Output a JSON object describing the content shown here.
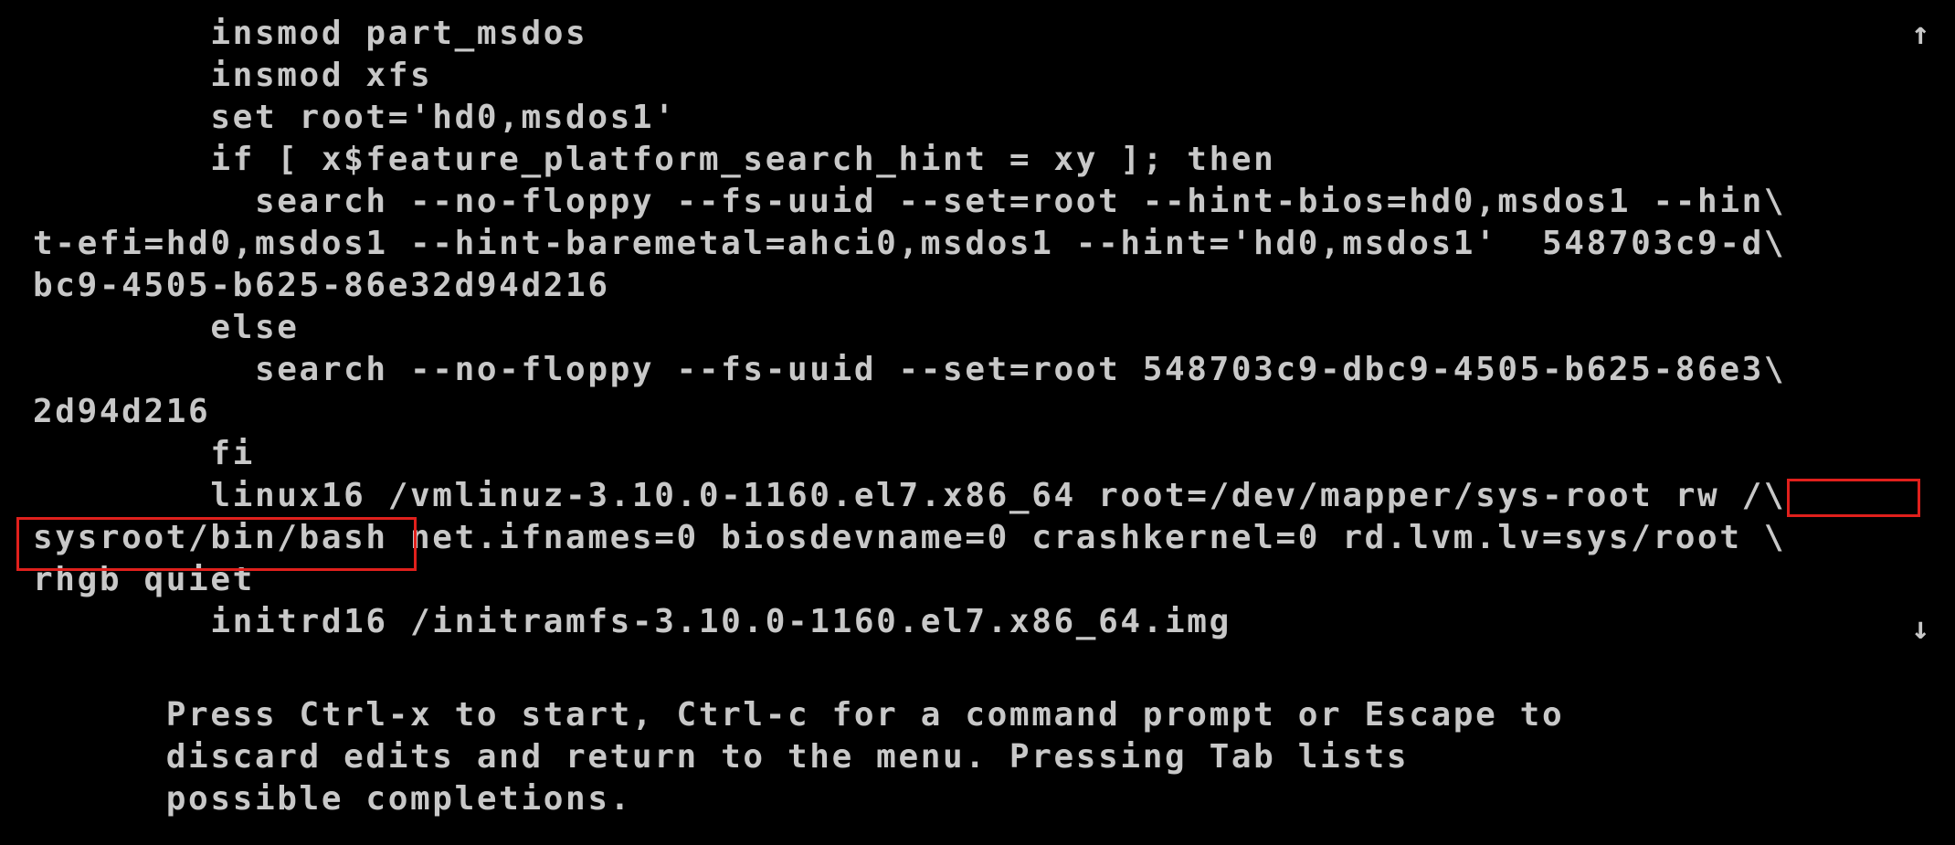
{
  "editor": {
    "scroll_up_icon": "↑",
    "scroll_down_icon": "↓",
    "lines": [
      "        insmod part_msdos",
      "        insmod xfs",
      "        set root='hd0,msdos1'",
      "        if [ x$feature_platform_search_hint = xy ]; then",
      "          search --no-floppy --fs-uuid --set=root --hint-bios=hd0,msdos1 --hin\\",
      "t-efi=hd0,msdos1 --hint-baremetal=ahci0,msdos1 --hint='hd0,msdos1'  548703c9-d\\",
      "bc9-4505-b625-86e32d94d216",
      "        else",
      "          search --no-floppy --fs-uuid --set=root 548703c9-dbc9-4505-b625-86e3\\",
      "2d94d216",
      "        fi",
      "        linux16 /vmlinuz-3.10.0-1160.el7.x86_64 root=/dev/mapper/sys-root rw /\\",
      "sysroot/bin/bash net.ifnames=0 biosdevname=0 crashkernel=0 rd.lvm.lv=sys/root \\",
      "rhgb quiet",
      "        initrd16 /initramfs-3.10.0-1160.el7.x86_64.img"
    ]
  },
  "help": {
    "lines": [
      "      Press Ctrl-x to start, Ctrl-c for a command prompt or Escape to",
      "      discard edits and return to the menu. Pressing Tab lists",
      "      possible completions."
    ]
  },
  "colors": {
    "background": "#000000",
    "text": "#c8c8c8",
    "annotation": "#e0201c"
  }
}
